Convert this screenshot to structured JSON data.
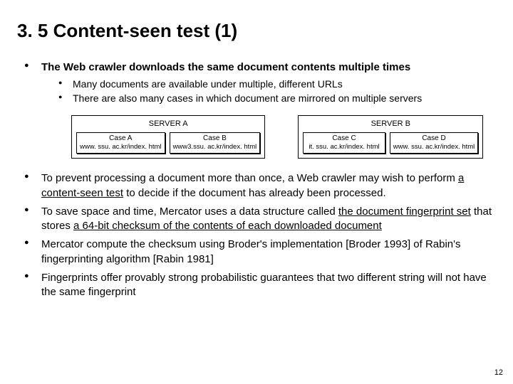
{
  "title": "3. 5 Content-seen test (1)",
  "bullet1": {
    "text": "The Web crawler downloads the same document contents multiple times",
    "sub1": "Many documents are available under multiple, different URLs",
    "sub2": "There are also many cases in which document are mirrored on multiple servers"
  },
  "serverA": {
    "label": "SERVER A",
    "caseA": {
      "name": "Case A",
      "url": "www. ssu. ac.kr/index. html"
    },
    "caseB": {
      "name": "Case B",
      "url": "www3.ssu. ac.kr/index. html"
    }
  },
  "serverB": {
    "label": "SERVER B",
    "caseC": {
      "name": "Case C",
      "url": "it. ssu. ac.kr/index. html"
    },
    "caseD": {
      "name": "Case D",
      "url": "www. ssu. ac.kr/index. html"
    }
  },
  "bullet2": {
    "pre": "To prevent processing a document more than once, a Web crawler may wish to perform ",
    "u": "a content-seen test",
    "post": " to decide if the document has already been processed."
  },
  "bullet3": {
    "pre": "To save space and time, Mercator uses a data structure called ",
    "u1": "the document fingerprint set",
    "mid": " that stores ",
    "u2": "a 64-bit checksum of the contents of each downloaded document"
  },
  "bullet4": "Mercator compute the checksum using Broder's implementation [Broder 1993] of Rabin's fingerprinting algorithm [Rabin 1981]",
  "bullet5": "Fingerprints offer provably strong probabilistic guarantees that two different string will not have the same fingerprint",
  "pagenum": "12"
}
